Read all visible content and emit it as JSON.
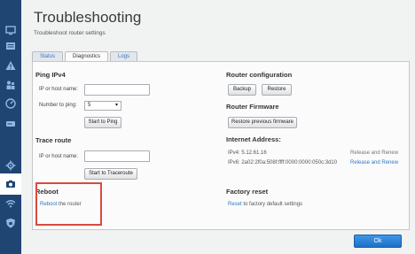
{
  "sidebar": {
    "items": [
      {
        "icon": "monitor-icon"
      },
      {
        "icon": "device-list-icon"
      },
      {
        "icon": "warning-icon"
      },
      {
        "icon": "people-icon"
      },
      {
        "icon": "speed-icon"
      },
      {
        "icon": "external-storage-icon"
      },
      {
        "icon": "connectivity-icon"
      },
      {
        "icon": "camera-icon"
      },
      {
        "icon": "wifi-icon"
      },
      {
        "icon": "security-shield-icon"
      }
    ],
    "active_index": 7
  },
  "header": {
    "title": "Troubleshooting",
    "subtitle": "Troubleshoot router settings"
  },
  "tabs": [
    {
      "label": "Status"
    },
    {
      "label": "Diagnostics"
    },
    {
      "label": "Logs"
    }
  ],
  "ping": {
    "heading": "Ping IPv4",
    "host_label": "IP or host name:",
    "host_value": "",
    "count_label": "Number to ping:",
    "count_value": "5",
    "button": "Start to Ping"
  },
  "trace": {
    "heading": "Trace route",
    "host_label": "IP or host name:",
    "host_value": "",
    "button": "Start to Traceroute"
  },
  "reboot": {
    "heading": "Reboot",
    "link": "Reboot",
    "text": " the router"
  },
  "router_config": {
    "heading": "Router configuration",
    "backup": "Backup",
    "restore": "Restore"
  },
  "firmware": {
    "heading": "Router Firmware",
    "button": "Restore previous firmware"
  },
  "internet": {
    "heading": "Internet Address:",
    "ipv4": "IPv4: 5.12.61.16",
    "ipv4_action": "Release and Renew",
    "ipv6": "IPv6: 2a02:2f0a:508f:ffff:0000:0000:050c:3d10",
    "ipv6_action": "Release and Renew"
  },
  "factory": {
    "heading": "Factory reset",
    "link": "Reset",
    "text": " to factory default settings"
  },
  "footer": {
    "ok": "Ok"
  },
  "colors": {
    "accent": "#2f78c4",
    "highlight": "#d94a3f",
    "sidebar": "#1f4573"
  }
}
